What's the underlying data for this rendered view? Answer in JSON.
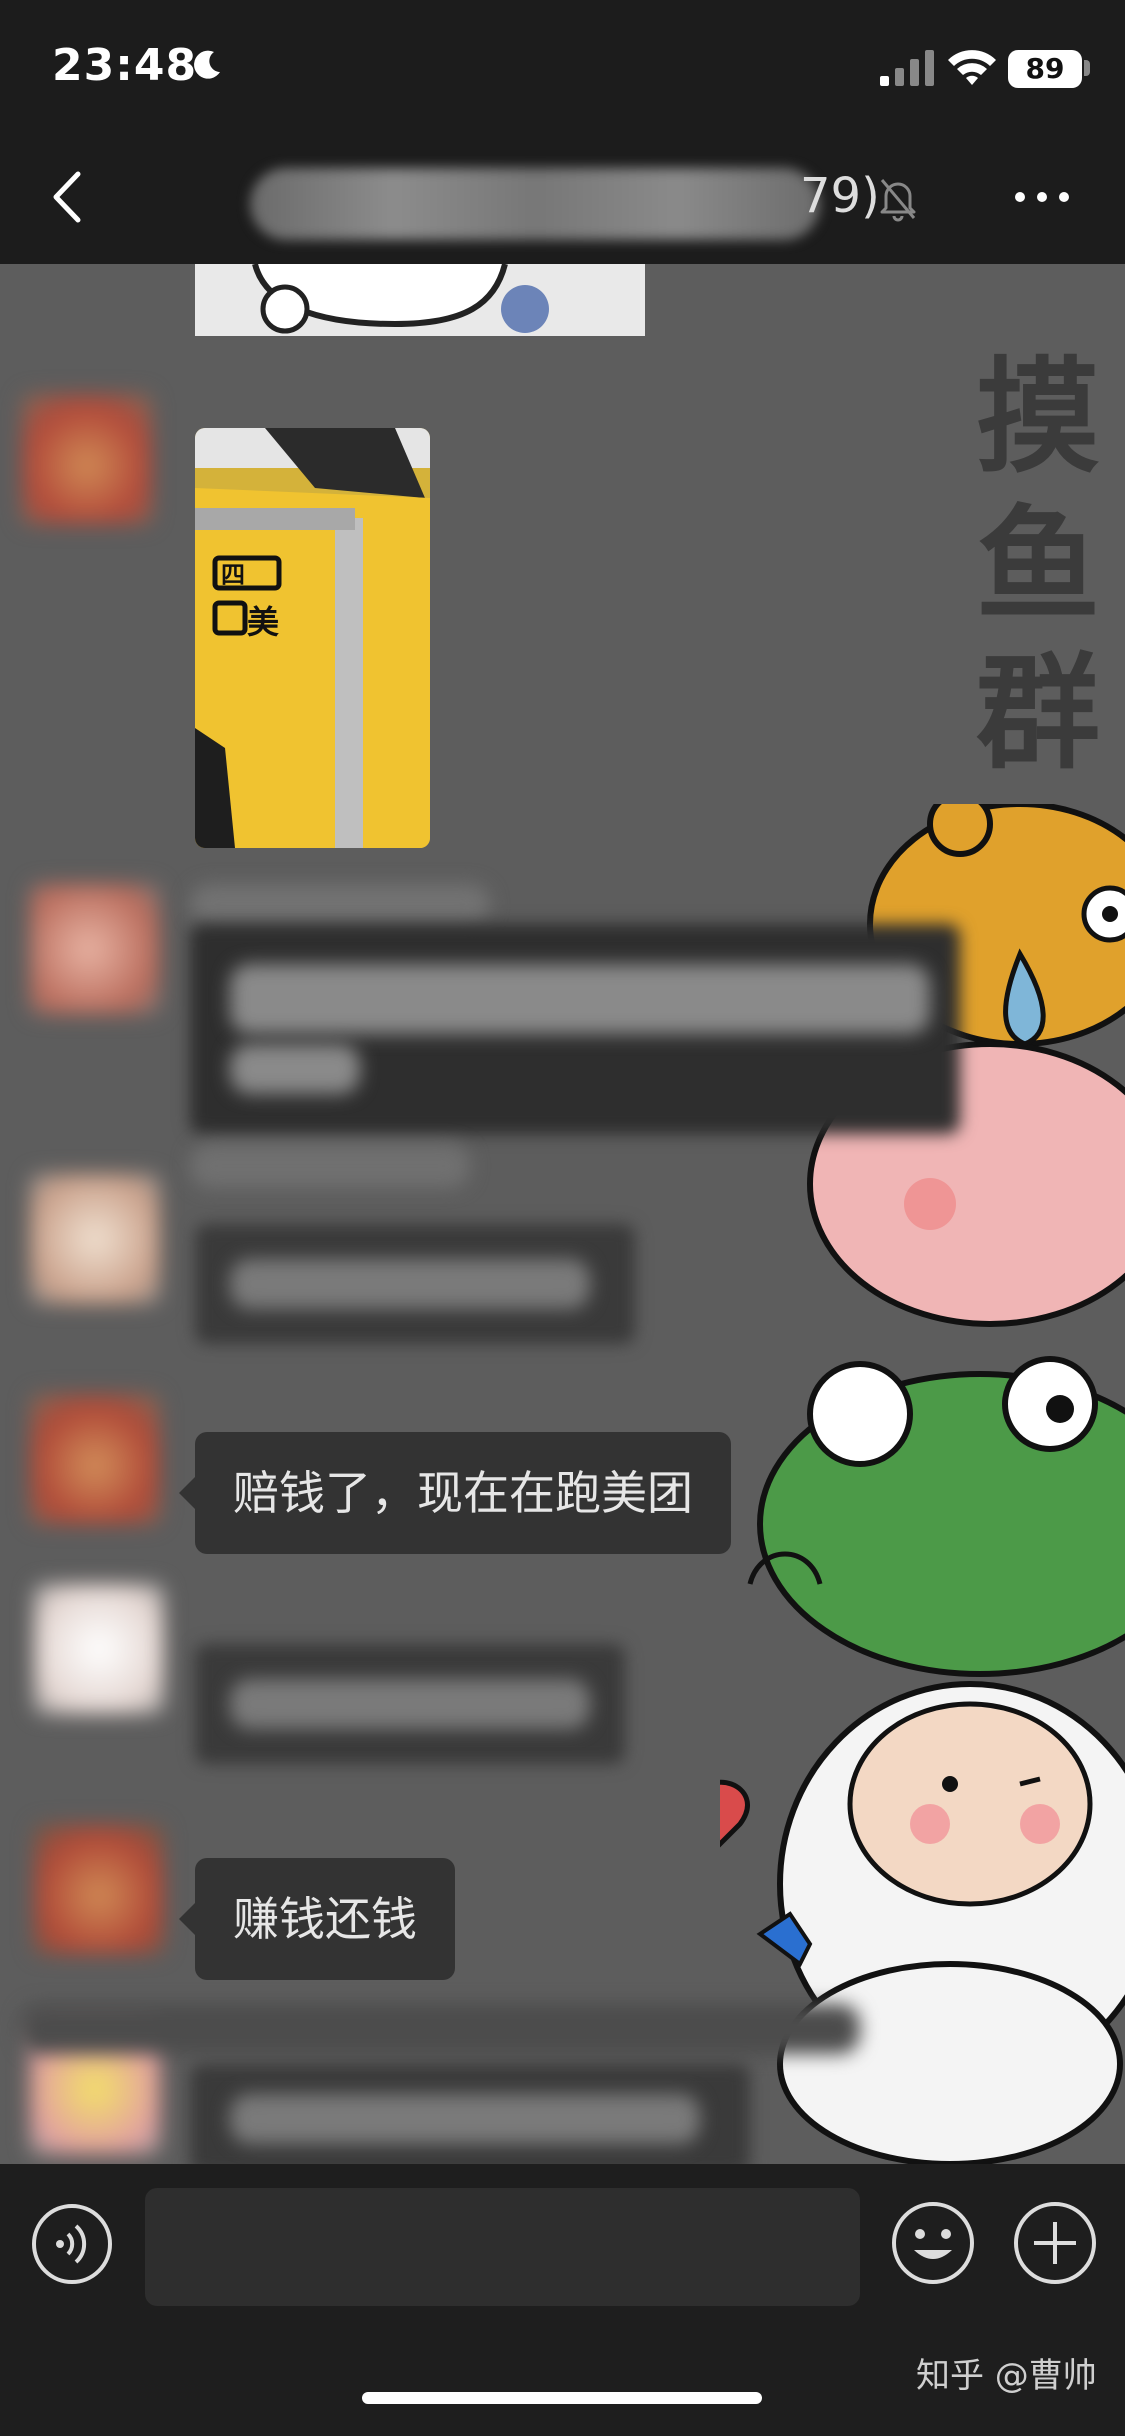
{
  "status_bar": {
    "time": "23:48",
    "battery": "89",
    "icons": [
      "moon-icon",
      "signal-icon",
      "wifi-icon",
      "battery-icon"
    ]
  },
  "nav": {
    "title_count": "79)",
    "icons": [
      "back-chevron-icon",
      "mute-bell-icon",
      "more-dots-icon"
    ]
  },
  "chat": {
    "background_title": "摸鱼群",
    "messages": [
      {
        "type": "image",
        "desc_icon": "photo-thumbnail"
      },
      {
        "type": "image",
        "desc_icon": "photo-jacket"
      },
      {
        "type": "blurred"
      },
      {
        "type": "blurred"
      },
      {
        "type": "text",
        "text": "赔钱了，现在在跑美团"
      },
      {
        "type": "blurred"
      },
      {
        "type": "text",
        "text": "赚钱还钱"
      },
      {
        "type": "blurred"
      }
    ]
  },
  "input_bar": {
    "icons": [
      "voice-icon",
      "emoji-icon",
      "plus-icon"
    ]
  },
  "watermark": "知乎 @曹帅",
  "colors": {
    "chat_background": "#5d5d5d",
    "bubble": "#333333",
    "bar": "#1c1c1c"
  }
}
